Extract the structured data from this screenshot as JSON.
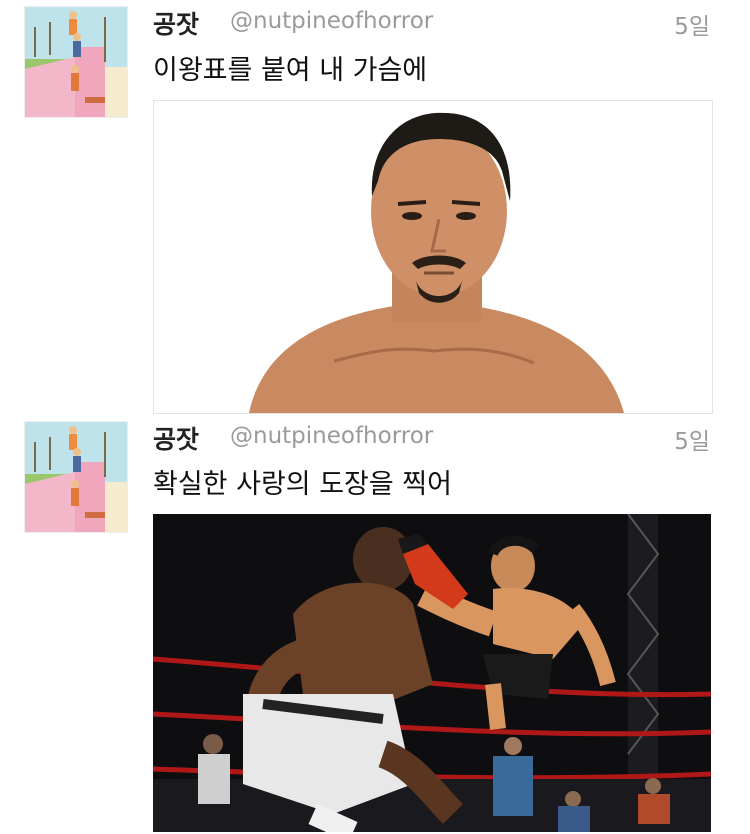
{
  "tweets": [
    {
      "name": "공잣",
      "handle": "@nutpineofhorror",
      "time": "5일",
      "text": "이왕표를 붙여 내 가슴에",
      "media_icon": "photo-portrait-man"
    },
    {
      "name": "공잣",
      "handle": "@nutpineofhorror",
      "time": "5일",
      "text": "확실한 사랑의 도장을 찍어",
      "media_icon": "photo-wrestling-dropkick"
    }
  ],
  "colors": {
    "name": "#222222",
    "handle": "#9a9a9a",
    "text": "#111111"
  }
}
